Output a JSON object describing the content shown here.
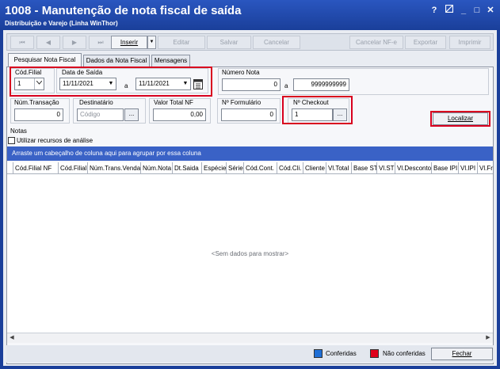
{
  "window": {
    "title": "1008 - Manutenção de nota fiscal de saída",
    "subtitle": "Distribuição e Varejo (Linha WinThor)",
    "help_glyph": "?",
    "minimize_glyph": "_",
    "maximize_glyph": "□",
    "close_glyph": "✕"
  },
  "toolbar": {
    "first": "⏮",
    "prev": "◀",
    "next": "▶",
    "last": "⏭",
    "inserir": "Inserir",
    "inserir_arrow": "▼",
    "editar": "Editar",
    "salvar": "Salvar",
    "cancelar": "Cancelar",
    "cancelar_nfe": "Cancelar NF-e",
    "exportar": "Exportar",
    "imprimir": "Imprimir"
  },
  "tabs": [
    {
      "label": "Pesquisar Nota Fiscal"
    },
    {
      "label": "Dados da Nota Fiscal"
    },
    {
      "label": "Mensagens"
    }
  ],
  "form": {
    "cod_filial_label": "Cód.Filial",
    "cod_filial_value": "1",
    "data_saida_label": "Data de Saída",
    "data_ini": "11/11/2021",
    "data_sep": "a",
    "data_fim": "11/11/2021",
    "numero_nota_label": "Número Nota",
    "numero_nota_ini": "0",
    "numero_nota_sep": "a",
    "numero_nota_fim": "9999999999",
    "num_transacao_label": "Núm.Transação",
    "num_transacao_value": "0",
    "destinatario_label": "Destinatário",
    "destinatario_placeholder": "Código",
    "valor_total_label": "Valor Total NF",
    "valor_total_value": "0,00",
    "formulario_label": "Nº Formulário",
    "formulario_value": "0",
    "checkout_label": "Nº Checkout",
    "checkout_value": "1",
    "dots": "...",
    "localizar": "Localizar"
  },
  "notas": {
    "label": "Notas",
    "analise_label": "Utilizar recursos de análise"
  },
  "grid": {
    "group_hint": "Arraste um cabeçalho de coluna aqui para agrupar por essa coluna",
    "columns": [
      "Cód.Filial NF",
      "Cód.Filial",
      "Núm.Trans.Venda",
      "Núm.Nota",
      "Dt.Saida",
      "Espécie",
      "Série",
      "Cód.Cont.",
      "Cód.Cli.",
      "Cliente",
      "Vl.Total",
      "Base ST",
      "Vl.ST",
      "Vl.Desconto",
      "Base IPI",
      "Vl.IPI",
      "Vl.Fre"
    ],
    "empty_message": "<Sem dados para mostrar>"
  },
  "status": {
    "conferidas_label": "Conferidas",
    "conferidas_color": "#1f6fd6",
    "nao_conferidas_label": "Não conferidas",
    "nao_conferidas_color": "#e0001b",
    "fechar": "Fechar"
  }
}
